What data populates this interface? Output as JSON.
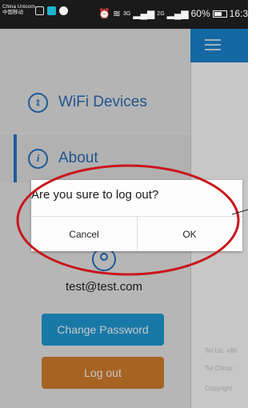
{
  "status_bar": {
    "carrier_line1": "China Unicom",
    "carrier_line2": "中国移动",
    "signal_text": "3G",
    "signal_text2": "2G",
    "battery": "60%",
    "time": "16:3"
  },
  "drawer": {
    "items": [
      {
        "label": "WiFi Devices",
        "icon": "plug-circle-icon"
      },
      {
        "label": "About",
        "icon": "info-icon"
      }
    ],
    "email": "test@test.com",
    "change_password_label": "Change Password",
    "logout_label": "Log out"
  },
  "content": {
    "footer": {
      "tel_us": "Tel Us: +86",
      "tel_china": "Tel China: :",
      "copyright": "Copyright"
    }
  },
  "dialog": {
    "message": "Are you sure to log out?",
    "cancel_label": "Cancel",
    "ok_label": "OK"
  },
  "colors": {
    "accent_blue": "#2876c4",
    "button_blue": "#1f9bd6",
    "button_orange": "#d77f2c",
    "annotation_red": "#c8171d"
  }
}
